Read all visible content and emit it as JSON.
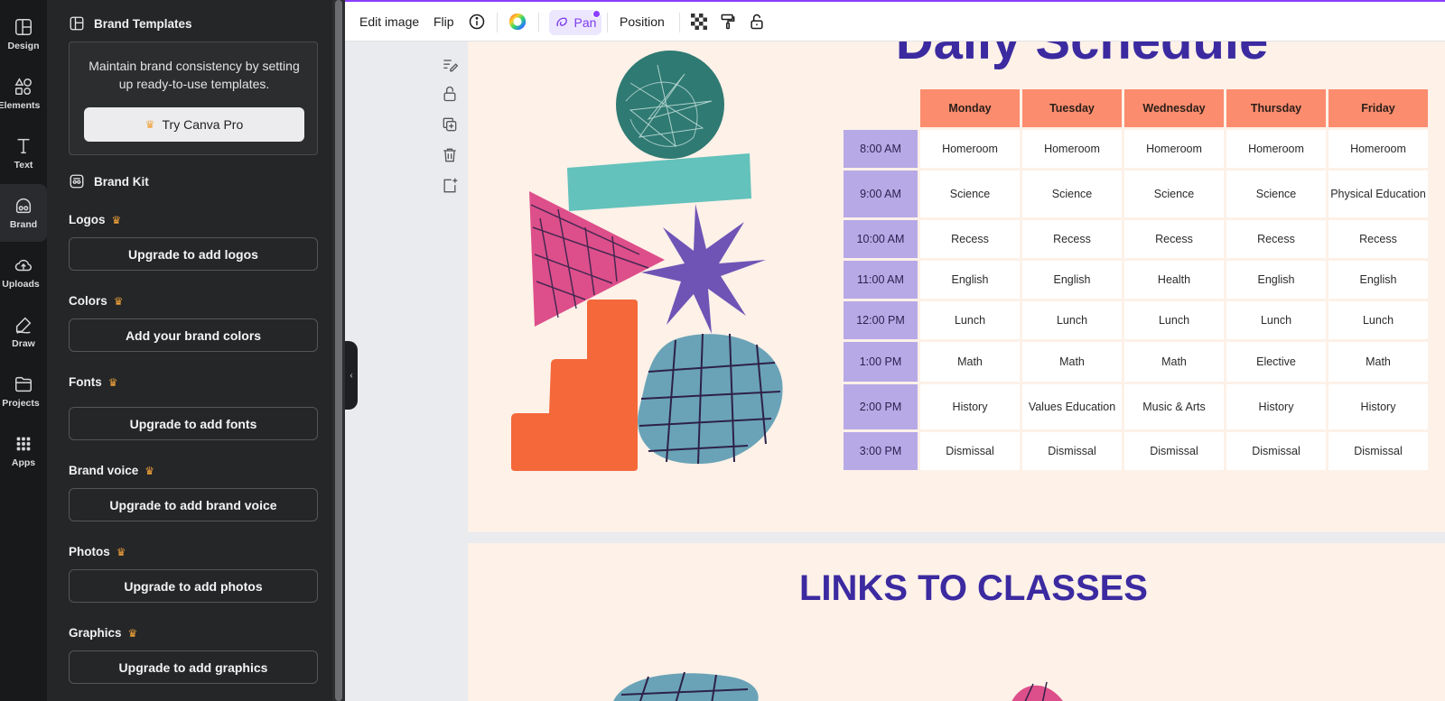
{
  "rail": {
    "items": [
      {
        "label": "Design",
        "icon": "layout-icon"
      },
      {
        "label": "Elements",
        "icon": "shapes-icon"
      },
      {
        "label": "Text",
        "icon": "text-icon"
      },
      {
        "label": "Brand",
        "icon": "brand-icon"
      },
      {
        "label": "Uploads",
        "icon": "cloud-upload-icon"
      },
      {
        "label": "Draw",
        "icon": "pen-icon"
      },
      {
        "label": "Projects",
        "icon": "folder-icon"
      },
      {
        "label": "Apps",
        "icon": "grid-icon"
      }
    ],
    "active": "Brand"
  },
  "panel": {
    "brand_templates": {
      "title": "Brand Templates",
      "description": "Maintain brand consistency by setting up ready-to-use templates.",
      "button": "Try Canva Pro"
    },
    "brand_kit": {
      "title": "Brand Kit",
      "sections": [
        {
          "label": "Logos",
          "button": "Upgrade to add logos"
        },
        {
          "label": "Colors",
          "button": "Add your brand colors"
        },
        {
          "label": "Fonts",
          "button": "Upgrade to add fonts"
        },
        {
          "label": "Brand voice",
          "button": "Upgrade to add brand voice"
        },
        {
          "label": "Photos",
          "button": "Upgrade to add photos"
        },
        {
          "label": "Graphics",
          "button": "Upgrade to add graphics"
        }
      ]
    }
  },
  "toolbar": {
    "edit_image": "Edit image",
    "flip": "Flip",
    "pan": "Pan",
    "position": "Position"
  },
  "canvas": {
    "title": "Daily Schedule",
    "links_title": "LINKS TO CLASSES",
    "schedule": {
      "days": [
        "Monday",
        "Tuesday",
        "Wednesday",
        "Thursday",
        "Friday"
      ],
      "rows": [
        {
          "time": "8:00 AM",
          "cells": [
            "Homeroom",
            "Homeroom",
            "Homeroom",
            "Homeroom",
            "Homeroom"
          ]
        },
        {
          "time": "9:00 AM",
          "cells": [
            "Science",
            "Science",
            "Science",
            "Science",
            "Physical Education"
          ]
        },
        {
          "time": "10:00 AM",
          "cells": [
            "Recess",
            "Recess",
            "Recess",
            "Recess",
            "Recess"
          ]
        },
        {
          "time": "11:00 AM",
          "cells": [
            "English",
            "English",
            "Health",
            "English",
            "English"
          ]
        },
        {
          "time": "12:00 PM",
          "cells": [
            "Lunch",
            "Lunch",
            "Lunch",
            "Lunch",
            "Lunch"
          ]
        },
        {
          "time": "1:00 PM",
          "cells": [
            "Math",
            "Math",
            "Math",
            "Elective",
            "Math"
          ]
        },
        {
          "time": "2:00 PM",
          "cells": [
            "History",
            "Values Education",
            "Music & Arts",
            "History",
            "History"
          ]
        },
        {
          "time": "3:00 PM",
          "cells": [
            "Dismissal",
            "Dismissal",
            "Dismissal",
            "Dismissal",
            "Dismissal"
          ]
        }
      ]
    }
  },
  "colors": {
    "accent": "#8b3dff",
    "title": "#3b2aa0",
    "header_cell": "#fb8c6e",
    "time_cell": "#b7a9e6",
    "page_bg": "#fdf1e8"
  }
}
